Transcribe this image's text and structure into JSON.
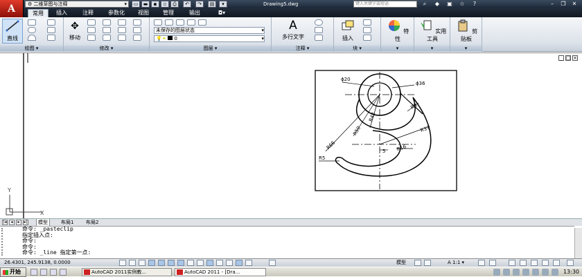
{
  "app": {
    "logo": "A",
    "workspace": "二维草图与注释",
    "document": "Drawing5.dwg",
    "search_placeholder": "键入关键字或短语"
  },
  "tabs": [
    {
      "label": "常用",
      "active": true
    },
    {
      "label": "插入"
    },
    {
      "label": "注释"
    },
    {
      "label": "参数化"
    },
    {
      "label": "视图"
    },
    {
      "label": "管理"
    },
    {
      "label": "输出"
    }
  ],
  "ribbon": {
    "line": "直线",
    "move": "移动",
    "layer_state": "未保存的图层状态",
    "layer_current": "0",
    "mtext": "多行文字",
    "insert": "插入",
    "properties": "特性",
    "utilities": "实用工具",
    "clipboard": "剪贴板",
    "panels": {
      "draw": "绘图 ▾",
      "modify": "修改 ▾",
      "layers": "图层 ▾",
      "annotation": "注释 ▾",
      "block": "块 ▾",
      "more": "▾"
    }
  },
  "drawing": {
    "dims": {
      "d20": "ϕ20",
      "d36": "ϕ36",
      "r8": "R8",
      "r42": "R42",
      "r50": "R50",
      "r37": "R37",
      "r66": "R66",
      "r16": "R16",
      "five": "5",
      "r5": "R5"
    },
    "ucs_x": "X",
    "ucs_y": "Y"
  },
  "layout_tabs": [
    {
      "label": "模型",
      "active": true
    },
    {
      "label": "布局1"
    },
    {
      "label": "布局2"
    }
  ],
  "command_lines": [
    "命令: _pasteclip",
    "指定插入点:",
    "命令:",
    "命令:",
    "命令: _line 指定第一点:"
  ],
  "status": {
    "coords": "26.4301, 245.9138, 0.0000",
    "model": "模型",
    "scale": "A 1:1 ▾"
  },
  "taskbar": {
    "start": "开始",
    "items": [
      {
        "label": "AutoCAD 2011实例教...",
        "active": false
      },
      {
        "label": "AutoCAD 2011 - [Dra...",
        "active": true
      }
    ],
    "clock": "13:30"
  }
}
